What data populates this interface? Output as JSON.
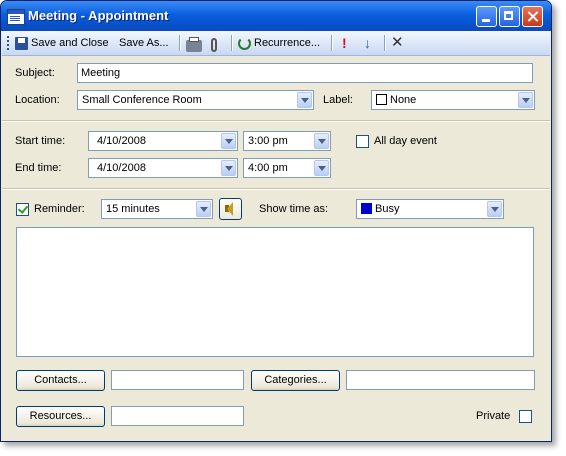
{
  "window": {
    "title": "Meeting - Appointment"
  },
  "toolbar": {
    "save_close": "Save and Close",
    "save_as": "Save As...",
    "recurrence": "Recurrence..."
  },
  "form": {
    "subject_label": "Subject:",
    "subject_value": "Meeting",
    "location_label": "Location:",
    "location_value": "Small Conference Room",
    "label_label": "Label:",
    "label_value": "None",
    "start_label": "Start time:",
    "start_date": "4/10/2008",
    "start_time": "3:00 pm",
    "end_label": "End time:",
    "end_date": "4/10/2008",
    "end_time": "4:00 pm",
    "all_day_label": "All day event",
    "all_day_checked": false,
    "reminder_label": "Reminder:",
    "reminder_checked": true,
    "reminder_value": "15 minutes",
    "show_time_label": "Show time as:",
    "show_time_value": "Busy",
    "show_time_color": "#0000cc",
    "label_color": "#ffffff"
  },
  "footer": {
    "contacts_button": "Contacts...",
    "contacts_value": "",
    "categories_button": "Categories...",
    "categories_value": "",
    "resources_button": "Resources...",
    "resources_value": "",
    "private_label": "Private",
    "private_checked": false
  }
}
